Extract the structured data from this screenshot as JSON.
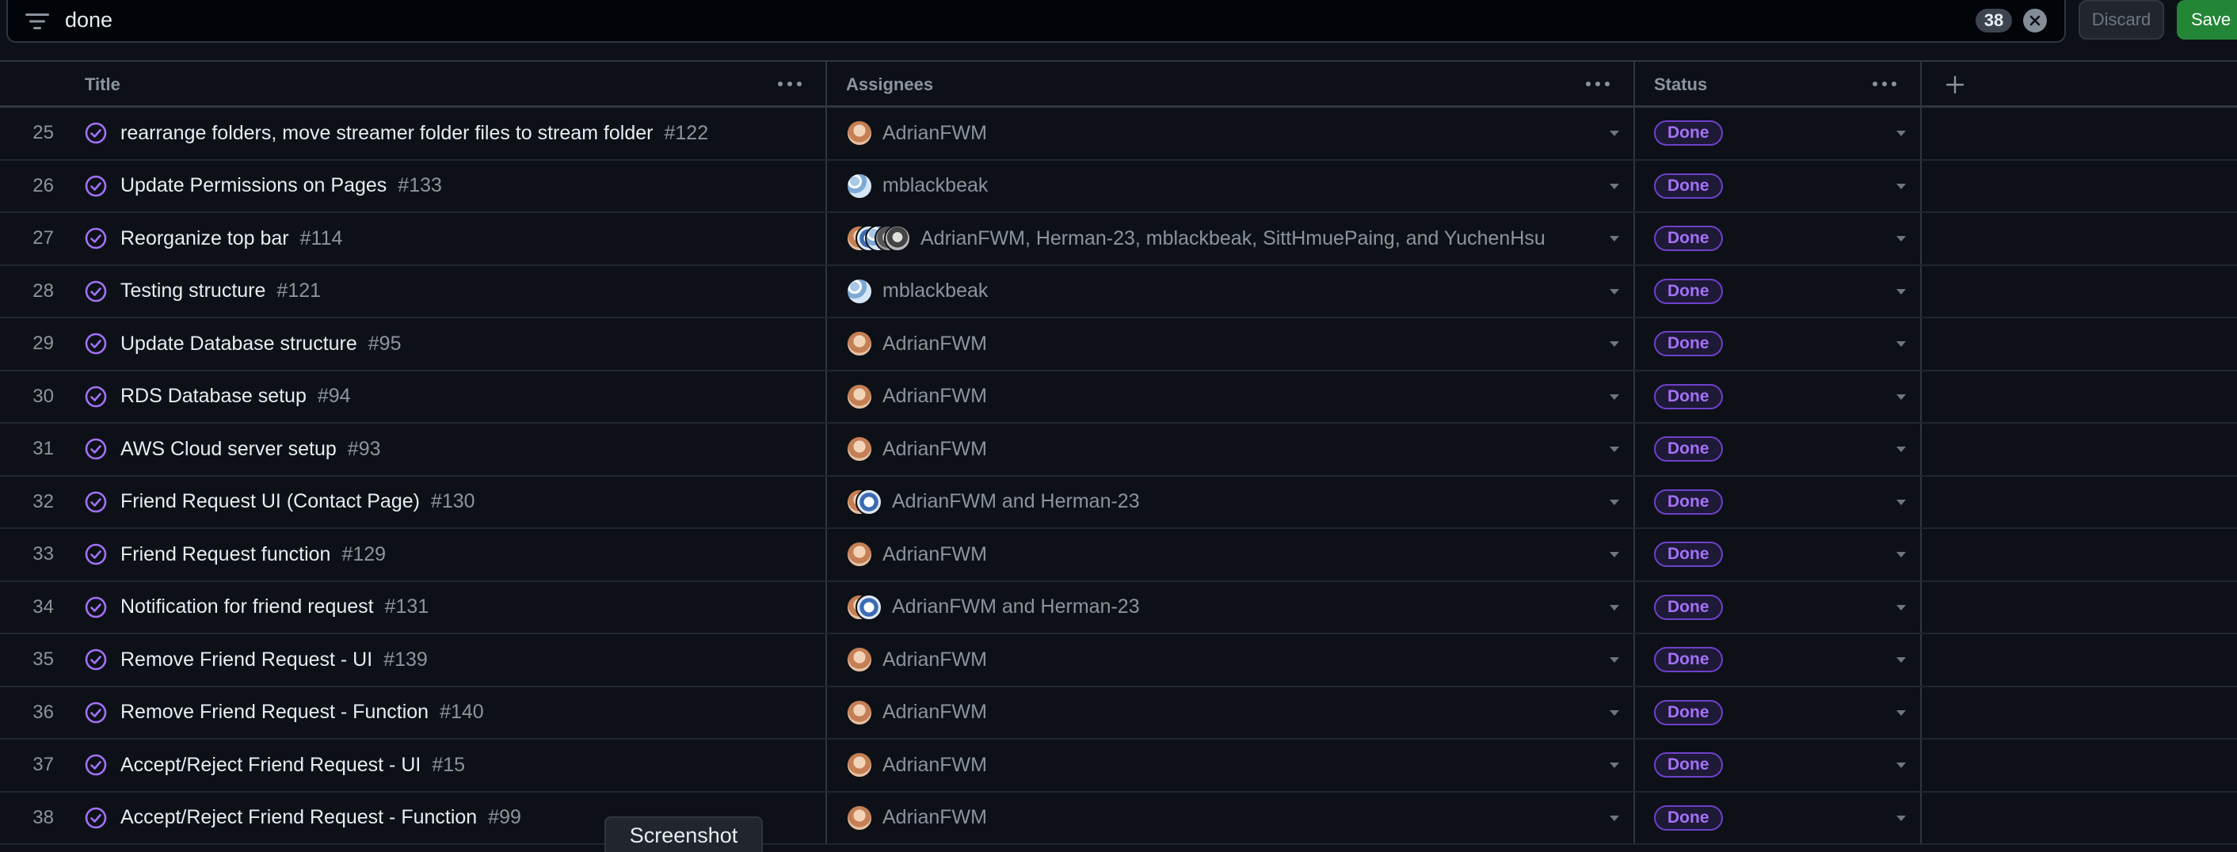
{
  "filter": {
    "query": "done",
    "count": "38",
    "discard_label": "Discard",
    "save_label": "Save"
  },
  "columns": {
    "title": "Title",
    "assignees": "Assignees",
    "status": "Status"
  },
  "icons": {
    "filter": "filter-icon",
    "clear": "close-circle-icon",
    "column_menu": "kebab-icon",
    "add_column": "plus-icon",
    "done": "issue-closed-icon",
    "dropdown": "triangle-down-icon"
  },
  "colors": {
    "background": "#0d1117",
    "border": "#30363d",
    "done_purple": "#a371f7",
    "save_green": "#238636"
  },
  "rows": [
    {
      "num": "25",
      "title": "rearrange folders, move streamer folder files to stream folder",
      "issue": "#122",
      "assignees": "AdrianFWM",
      "avatars": [
        "adrian"
      ],
      "status": "Done"
    },
    {
      "num": "26",
      "title": "Update Permissions on Pages",
      "issue": "#133",
      "assignees": "mblackbeak",
      "avatars": [
        "mblack"
      ],
      "status": "Done"
    },
    {
      "num": "27",
      "title": "Reorganize top bar",
      "issue": "#114",
      "assignees": "AdrianFWM, Herman-23, mblackbeak, SittHmuePaing, and YuchenHsu",
      "avatars": [
        "adrian",
        "herman",
        "mblack",
        "sitt",
        "yuchen"
      ],
      "status": "Done"
    },
    {
      "num": "28",
      "title": "Testing structure",
      "issue": "#121",
      "assignees": "mblackbeak",
      "avatars": [
        "mblack"
      ],
      "status": "Done"
    },
    {
      "num": "29",
      "title": "Update Database structure",
      "issue": "#95",
      "assignees": "AdrianFWM",
      "avatars": [
        "adrian"
      ],
      "status": "Done"
    },
    {
      "num": "30",
      "title": "RDS Database setup",
      "issue": "#94",
      "assignees": "AdrianFWM",
      "avatars": [
        "adrian"
      ],
      "status": "Done"
    },
    {
      "num": "31",
      "title": "AWS Cloud server setup",
      "issue": "#93",
      "assignees": "AdrianFWM",
      "avatars": [
        "adrian"
      ],
      "status": "Done"
    },
    {
      "num": "32",
      "title": "Friend Request UI (Contact Page)",
      "issue": "#130",
      "assignees": "AdrianFWM and Herman-23",
      "avatars": [
        "adrian",
        "herman"
      ],
      "status": "Done"
    },
    {
      "num": "33",
      "title": "Friend Request function",
      "issue": "#129",
      "assignees": "AdrianFWM",
      "avatars": [
        "adrian"
      ],
      "status": "Done"
    },
    {
      "num": "34",
      "title": "Notification for friend request",
      "issue": "#131",
      "assignees": "AdrianFWM and Herman-23",
      "avatars": [
        "adrian",
        "herman"
      ],
      "status": "Done"
    },
    {
      "num": "35",
      "title": "Remove Friend Request - UI",
      "issue": "#139",
      "assignees": "AdrianFWM",
      "avatars": [
        "adrian"
      ],
      "status": "Done"
    },
    {
      "num": "36",
      "title": "Remove Friend Request - Function",
      "issue": "#140",
      "assignees": "AdrianFWM",
      "avatars": [
        "adrian"
      ],
      "status": "Done"
    },
    {
      "num": "37",
      "title": "Accept/Reject Friend Request - UI",
      "issue": "#15",
      "assignees": "AdrianFWM",
      "avatars": [
        "adrian"
      ],
      "status": "Done"
    },
    {
      "num": "38",
      "title": "Accept/Reject Friend Request - Function",
      "issue": "#99",
      "assignees": "AdrianFWM",
      "avatars": [
        "adrian"
      ],
      "status": "Done"
    }
  ],
  "tooltip": "Screenshot"
}
